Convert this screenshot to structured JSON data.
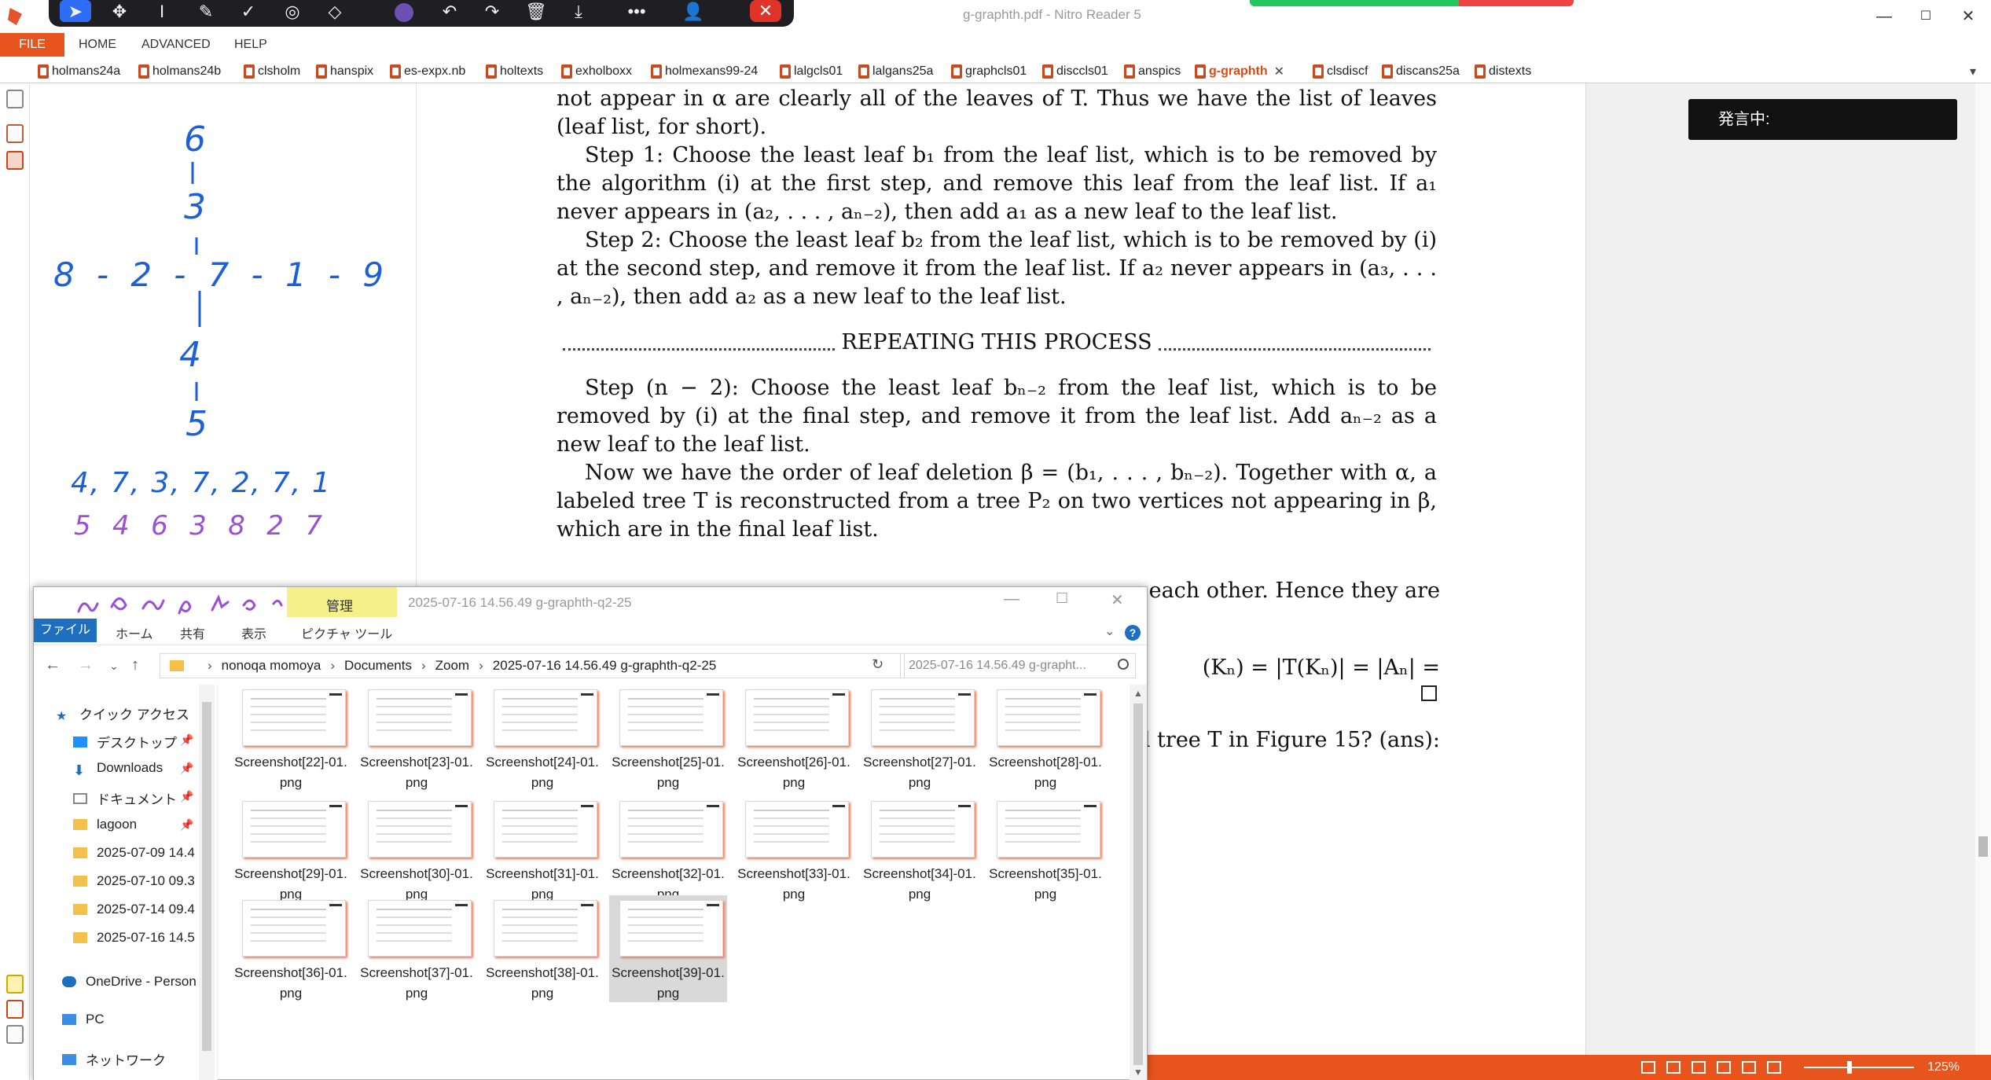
{
  "window": {
    "title": "g-graphth.pdf - Nitro Reader 5",
    "minimize": "—",
    "maximize": "☐",
    "close": "✕"
  },
  "annotation_toolbar": {
    "tools": [
      "select-tool",
      "move-tool",
      "text-tool",
      "pen-tool",
      "check-tool",
      "stamp-tool",
      "eraser-tool",
      "color-tool",
      "undo-tool",
      "redo-tool",
      "delete-tool",
      "download-tool",
      "more-tool",
      "user-tool",
      "close-tool"
    ],
    "color": "#6b4fb2"
  },
  "menu": {
    "file": "FILE",
    "home": "HOME",
    "advanced": "ADVANCED",
    "help": "HELP"
  },
  "doc_tabs": [
    {
      "label": "holmans24a"
    },
    {
      "label": "holmans24b"
    },
    {
      "label": "clsholm"
    },
    {
      "label": "hanspix"
    },
    {
      "label": "es-expx.nb"
    },
    {
      "label": "holtexts"
    },
    {
      "label": "exholboxx"
    },
    {
      "label": "holmexans99-24"
    },
    {
      "label": "lalgcls01"
    },
    {
      "label": "lalgans25a"
    },
    {
      "label": "graphcls01"
    },
    {
      "label": "disccls01"
    },
    {
      "label": "anspics"
    },
    {
      "label": "g-graphth",
      "active": true
    },
    {
      "label": "clsdiscf"
    },
    {
      "label": "discans25a"
    },
    {
      "label": "distexts"
    }
  ],
  "handwriting": {
    "tree_top": [
      "6",
      "1",
      "3",
      "1"
    ],
    "tree_row": "8 - 2 - 7 - 1 - 9",
    "tree_bottom": [
      "1",
      "4",
      "1",
      "5"
    ],
    "sequence_blue": "4, 7, 3, 7, 2, 7, 1",
    "sequence_purple": "5 4 6 3 8 2 7"
  },
  "document": {
    "lines_top": "not appear in α are clearly all of the leaves of T. Thus we have the list of leaves (leaf list, for short).",
    "step1": "Step 1: Choose the least leaf b₁ from the leaf list, which is to be removed by the algorithm (i) at the first step, and remove this leaf from the leaf list. If a₁ never appears in (a₂, . . . , aₙ₋₂), then add a₁ as a new leaf to the leaf list.",
    "step2": "Step 2: Choose the least leaf b₂ from the leaf list, which is to be removed by (i) at the second step, and remove it from the leaf list. If a₂ never appears in (a₃, . . . , aₙ₋₂), then add a₂ as a new leaf to the leaf list.",
    "repeat": "REPEATING THIS PROCESS",
    "step_n2": "Step (n − 2): Choose the least leaf bₙ₋₂ from the leaf list, which is to be removed by (i) at the final step, and remove it from the leaf list. Add aₙ₋₂ as a new leaf to the leaf list.",
    "now_para": "Now we have the order of leaf deletion β = (b₁, . . . , bₙ₋₂). Together with α, a labeled tree T is reconstructed from a tree P₂ on two vertices not appearing in β, which are in the final leaf list.",
    "right_line1": "each other.  Hence they are",
    "right_line2": "(Kₙ)  =  |T(Kₙ)|  =  |Aₙ|  =",
    "right_line3": "l tree T in Figure 15? (ans):"
  },
  "speech_panel": {
    "label": "発言中:"
  },
  "statusbar": {
    "zoom": "125%"
  },
  "explorer": {
    "title": "2025-07-16 14.56.49 g-graphth-q2-25",
    "manage": "管理",
    "ribbon": {
      "file": "ファイル",
      "home": "ホーム",
      "share": "共有",
      "view": "表示",
      "picture_tools": "ピクチャ ツール"
    },
    "breadcrumb": [
      "nonoqa momoya",
      "Documents",
      "Zoom",
      "2025-07-16 14.56.49 g-graphth-q2-25"
    ],
    "search_placeholder": "2025-07-16 14.56.49 g-grapht...",
    "nav": [
      {
        "label": "クイック アクセス",
        "icon": "star-icon"
      },
      {
        "label": "デスクトップ",
        "icon": "desktop-icon",
        "pinned": true
      },
      {
        "label": "Downloads",
        "icon": "download-icon",
        "pinned": true
      },
      {
        "label": "ドキュメント",
        "icon": "document-icon",
        "pinned": true
      },
      {
        "label": "lagoon",
        "icon": "folder-icon",
        "pinned": true
      },
      {
        "label": "2025-07-09 14.4",
        "icon": "folder-icon"
      },
      {
        "label": "2025-07-10 09.3",
        "icon": "folder-icon"
      },
      {
        "label": "2025-07-14 09.4",
        "icon": "folder-icon"
      },
      {
        "label": "2025-07-16 14.5",
        "icon": "folder-icon"
      },
      {
        "label": "OneDrive - Person",
        "icon": "cloud-icon"
      },
      {
        "label": "PC",
        "icon": "pc-icon"
      },
      {
        "label": "ネットワーク",
        "icon": "network-icon"
      }
    ],
    "files": [
      "Screenshot[22]-01.png",
      "Screenshot[23]-01.png",
      "Screenshot[24]-01.png",
      "Screenshot[25]-01.png",
      "Screenshot[26]-01.png",
      "Screenshot[27]-01.png",
      "Screenshot[28]-01.png",
      "Screenshot[29]-01.png",
      "Screenshot[30]-01.png",
      "Screenshot[31]-01.png",
      "Screenshot[32]-01.png",
      "Screenshot[33]-01.png",
      "Screenshot[34]-01.png",
      "Screenshot[35]-01.png",
      "Screenshot[36]-01.png",
      "Screenshot[37]-01.png",
      "Screenshot[38]-01.png",
      "Screenshot[39]-01.png"
    ],
    "selected_file": "Screenshot[39]-01.png"
  },
  "colors": {
    "accent": "#e8541e",
    "ink_blue": "#1d5fd6",
    "ink_purple": "#9a4fd6"
  }
}
